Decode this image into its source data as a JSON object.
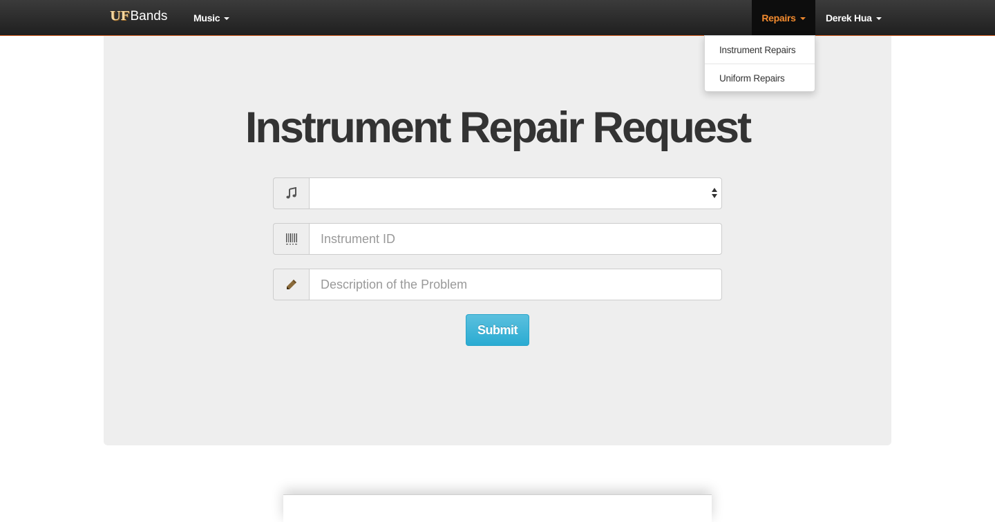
{
  "navbar": {
    "brand_uf": "UF",
    "brand_bands": "Bands",
    "music_label": "Music",
    "repairs_label": "Repairs",
    "user_label": "Derek Hua",
    "accent_color": "#f28a2e",
    "active_item": "Repairs"
  },
  "repairs_menu": {
    "items": [
      {
        "label": "Instrument Repairs"
      },
      {
        "label": "Uniform Repairs"
      }
    ]
  },
  "main": {
    "title": "Instrument Repair Request",
    "fields": [
      {
        "icon": "music-note-icon",
        "type": "select",
        "value": ""
      },
      {
        "icon": "barcode-icon",
        "type": "text",
        "placeholder": "Instrument ID"
      },
      {
        "icon": "pencil-icon",
        "type": "text",
        "placeholder": "Description of the Problem"
      }
    ],
    "submit_label": "Submit",
    "submit_color": "#5bc0de"
  }
}
